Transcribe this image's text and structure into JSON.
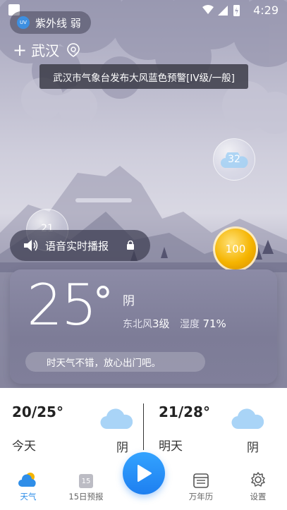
{
  "status": {
    "time": "4:29"
  },
  "uv": {
    "badge": "UV",
    "label": "紫外线 弱"
  },
  "location": {
    "add_symbol": "+",
    "city": "武汉"
  },
  "alert": {
    "text": "武汉市气象台发布大风蓝色预警[IV级/一般]"
  },
  "bubbles": [
    {
      "value": "32"
    },
    {
      "value": "21"
    }
  ],
  "coin": {
    "value": "100"
  },
  "voice": {
    "label": "语音实时播报"
  },
  "current": {
    "temperature": "25",
    "degree": "°",
    "condition": "阴",
    "wind_label": "东北风",
    "wind_level": "3级",
    "humidity_label": "湿度",
    "humidity_value": "71%",
    "tip": "时天气不错，放心出门吧。"
  },
  "forecast": {
    "today": {
      "temps": "20/25°",
      "day": "今天",
      "condition": "阴"
    },
    "tomorrow": {
      "temps": "21/28°",
      "day": "明天",
      "condition": "阴"
    }
  },
  "tabs": [
    {
      "label": "天气",
      "icon": "weather-icon",
      "active": true
    },
    {
      "label": "15日预报",
      "icon": "calendar-15-icon",
      "badge": "15"
    },
    {
      "label": "万年历",
      "icon": "almanac-icon"
    },
    {
      "label": "设置",
      "icon": "settings-gear-icon"
    }
  ],
  "colors": {
    "accent": "#2f8ee8",
    "coin": "#f5b400",
    "card": "#807f9a"
  }
}
